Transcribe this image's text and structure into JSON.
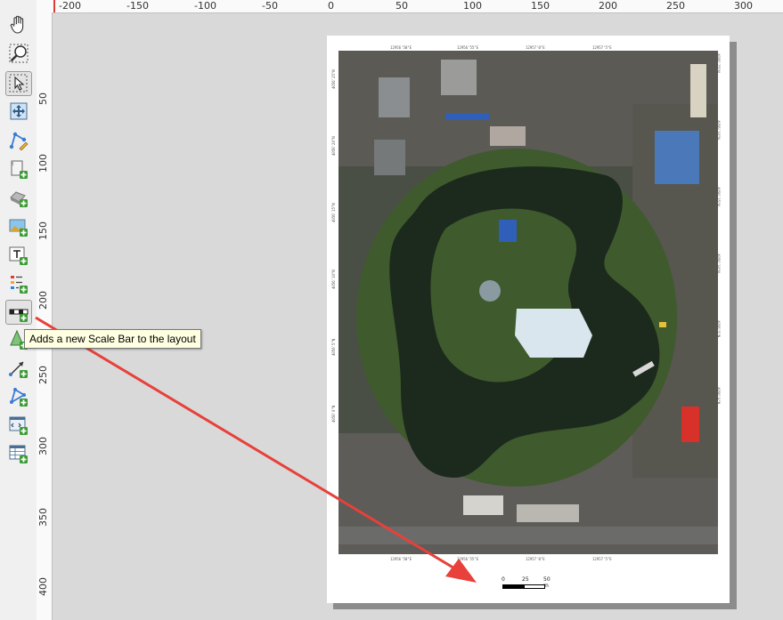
{
  "tooltip": {
    "text": "Adds a new Scale Bar to the layout"
  },
  "toolbar": {
    "tools": [
      {
        "name": "pan-layout",
        "icon": "hand-icon"
      },
      {
        "name": "zoom",
        "icon": "zoom-icon"
      },
      {
        "name": "select-move-item",
        "icon": "select-arrow-icon"
      },
      {
        "name": "move-item-content",
        "icon": "move-content-icon"
      },
      {
        "name": "edit-nodes",
        "icon": "edit-nodes-icon"
      },
      {
        "name": "add-map",
        "icon": "add-map-icon"
      },
      {
        "name": "add-3d-map",
        "icon": "add-3d-map-icon"
      },
      {
        "name": "add-picture",
        "icon": "add-picture-icon"
      },
      {
        "name": "add-label",
        "icon": "add-label-icon"
      },
      {
        "name": "add-legend",
        "icon": "add-legend-icon"
      },
      {
        "name": "add-scale-bar",
        "icon": "scale-bar-icon"
      },
      {
        "name": "add-north-arrow",
        "icon": "north-arrow-icon"
      },
      {
        "name": "add-polyline",
        "icon": "polyline-icon"
      },
      {
        "name": "add-polygon",
        "icon": "polygon-icon"
      },
      {
        "name": "add-html",
        "icon": "html-icon"
      },
      {
        "name": "add-attribute-table",
        "icon": "attribute-table-icon"
      }
    ]
  },
  "rulers": {
    "horizontal": [
      "-200",
      "-150",
      "-100",
      "-50",
      "0",
      "50",
      "100",
      "150",
      "200",
      "250",
      "300"
    ],
    "vertical": [
      "50",
      "100",
      "150",
      "200",
      "250",
      "300",
      "350",
      "400"
    ]
  },
  "map_frame": {
    "top_labels": [
      "12956'50\"E",
      "12956'55\"E",
      "12957'0\"E",
      "12957'5\"E"
    ],
    "bottom_labels": [
      "12956'50\"E",
      "12956'55\"E",
      "12957'0\"E",
      "12957'5\"E"
    ],
    "left_labels": [
      "4056'25\"N",
      "4056'20\"N",
      "4056'15\"N",
      "4056'10\"N",
      "4056'5\"N",
      "4056'0\"N"
    ],
    "right_labels": [
      "4056'25\"N",
      "4056'20\"N",
      "4056'15\"N",
      "4056'10\"N",
      "4056'5\"N",
      "4056'0\"N"
    ]
  },
  "scale_bar": {
    "labels": [
      "0",
      "25",
      "50 m"
    ]
  },
  "colors": {
    "arrow": "#e8403a",
    "tooltip_bg": "#ffffe1",
    "water": "#1c2a1e",
    "vegetation": "#3f5a2c"
  }
}
